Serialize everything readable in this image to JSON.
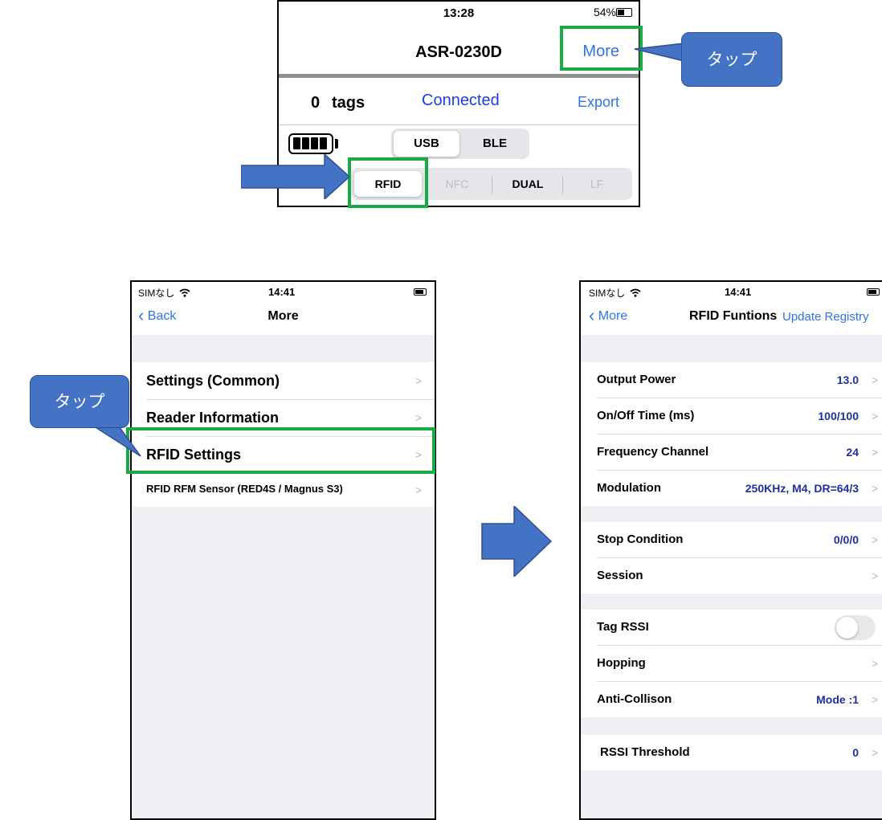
{
  "top": {
    "time": "13:28",
    "battery_pct": "54%",
    "title": "ASR-0230D",
    "more": "More",
    "tag_count": "0",
    "tag_word": "tags",
    "status": "Connected",
    "export": "Export",
    "conn_tabs": [
      "USB",
      "BLE"
    ],
    "mode_tabs": [
      "RFID",
      "NFC",
      "DUAL",
      "LF"
    ]
  },
  "callouts": {
    "top": "タップ",
    "left": "タップ"
  },
  "more_screen": {
    "carrier": "SIMなし",
    "time": "14:41",
    "back": "Back",
    "title": "More",
    "items": [
      "Settings (Common)",
      "Reader Information",
      "RFID Settings",
      "RFID RFM Sensor (RED4S / Magnus S3)"
    ]
  },
  "rfid_screen": {
    "carrier": "SIMなし",
    "time": "14:41",
    "back": "More",
    "title": "RFID Funtions",
    "action": "Update Registry",
    "rows": [
      {
        "label": "Output Power",
        "value": "13.0"
      },
      {
        "label": "On/Off Time (ms)",
        "value": "100/100"
      },
      {
        "label": "Frequency Channel",
        "value": "24"
      },
      {
        "label": "Modulation",
        "value": "250KHz, M4, DR=64/3"
      },
      {
        "label": "Stop Condition",
        "value": "0/0/0"
      },
      {
        "label": "Session",
        "value": ""
      },
      {
        "label": "Tag RSSI",
        "value": ""
      },
      {
        "label": "Hopping",
        "value": ""
      },
      {
        "label": "Anti-Collison",
        "value": "Mode :1"
      },
      {
        "label": "RSSI Threshold",
        "value": "0"
      }
    ],
    "tag_rssi_on": false
  },
  "colors": {
    "highlight": "#1aaa45",
    "callout": "#4472c4",
    "link": "#2f73e6",
    "value": "#1f2f9e"
  }
}
